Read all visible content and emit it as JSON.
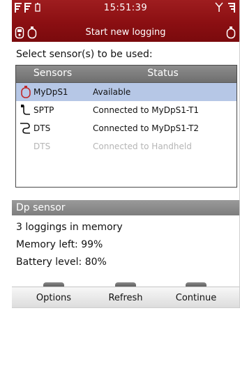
{
  "status_bar": {
    "time": "15:51:39",
    "title": "Start new logging"
  },
  "icons": {
    "status_left": [
      "signal-icon",
      "signal-icon",
      "battery-icon"
    ],
    "status_right": [
      "antenna-icon",
      "signal-icon"
    ],
    "left_devices": [
      "handheld-icon",
      "probe-icon"
    ],
    "right_device": "probe-icon"
  },
  "prompt": "Select sensor(s) to be used:",
  "sensor_table": {
    "columns": [
      "Sensors",
      "Status"
    ],
    "rows": [
      {
        "icon": "dp-sensor-icon",
        "name": "MyDpS1",
        "status": "Available",
        "selected": true,
        "dimmed": false
      },
      {
        "icon": "sptp-probe-icon",
        "name": "SPTP",
        "status": "Connected to MyDpS1-T1",
        "selected": false,
        "dimmed": false
      },
      {
        "icon": "dts-probe-icon",
        "name": "DTS",
        "status": "Connected to MyDpS1-T2",
        "selected": false,
        "dimmed": false
      },
      {
        "icon": "",
        "name": "DTS",
        "status": "Connected to Handheld",
        "selected": false,
        "dimmed": true
      }
    ]
  },
  "details": {
    "heading": "Dp sensor",
    "lines": [
      "3 loggings in memory",
      "Memory left: 99%",
      "Battery level: 80%"
    ]
  },
  "softkeys": {
    "left": "Options",
    "center": "Refresh",
    "right": "Continue"
  },
  "colors": {
    "header": "#8b0f12",
    "selection": "#b6c7e6",
    "section_bar": "#8a8a8a",
    "dim_text": "#b5b5b5"
  }
}
